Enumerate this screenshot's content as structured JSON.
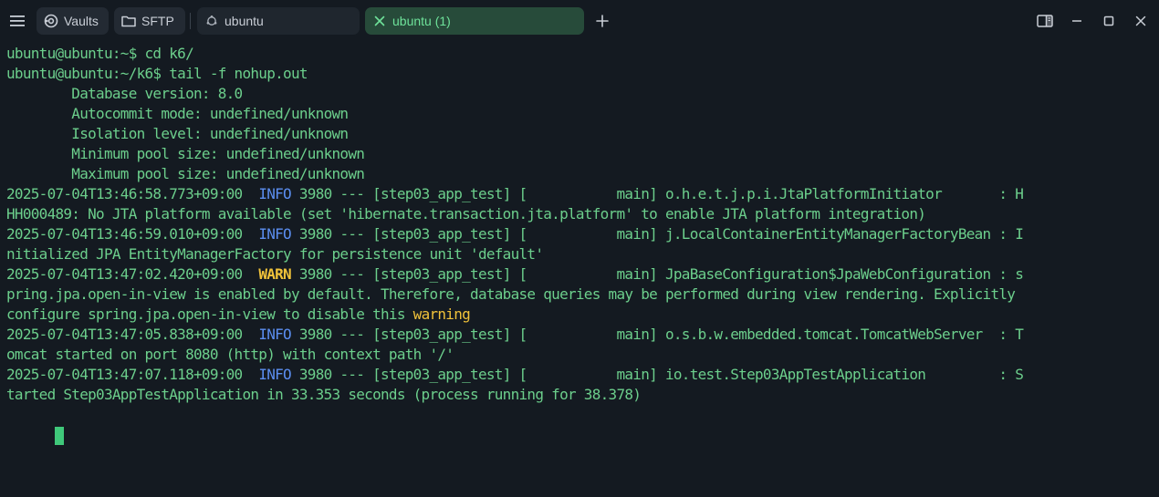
{
  "tabs": {
    "vaults": "Vaults",
    "sftp": "SFTP",
    "host": "ubuntu",
    "active": "ubuntu (1)"
  },
  "colors": {
    "background": "#141a21",
    "text": "#6ccf8c",
    "info": "#5b8ef0",
    "warn": "#f0c23a",
    "active_tab_bg": "#274b3a",
    "active_tab_text": "#6ee29a"
  },
  "icons": {
    "menu": "hamburger-icon",
    "vaults": "vault-icon",
    "sftp": "folder-icon",
    "host": "ubuntu-icon",
    "active": "close-icon",
    "new_tab": "plus-icon",
    "panel": "split-panel-icon",
    "minimize": "minimize-icon",
    "maximize": "maximize-icon",
    "close": "close-window-icon"
  },
  "terminal": {
    "lines": [
      {
        "segments": [
          {
            "text": "ubuntu@ubuntu:~$ cd k6/"
          }
        ]
      },
      {
        "segments": [
          {
            "text": "ubuntu@ubuntu:~/k6$ tail -f nohup.out"
          }
        ]
      },
      {
        "segments": [
          {
            "text": "        Database version: 8.0"
          }
        ]
      },
      {
        "segments": [
          {
            "text": "        Autocommit mode: undefined/unknown"
          }
        ]
      },
      {
        "segments": [
          {
            "text": "        Isolation level: undefined/unknown"
          }
        ]
      },
      {
        "segments": [
          {
            "text": "        Minimum pool size: undefined/unknown"
          }
        ]
      },
      {
        "segments": [
          {
            "text": "        Maximum pool size: undefined/unknown"
          }
        ]
      },
      {
        "segments": [
          {
            "text": "2025-07-04T13:46:58.773+09:00  "
          },
          {
            "text": "INFO",
            "cls": "lvl-info"
          },
          {
            "text": " 3980 --- [step03_app_test] [           main] o.h.e.t.j.p.i.JtaPlatformInitiator       : H"
          }
        ]
      },
      {
        "segments": [
          {
            "text": "HH000489: No JTA platform available (set 'hibernate.transaction.jta.platform' to enable JTA platform integration)"
          }
        ]
      },
      {
        "segments": [
          {
            "text": "2025-07-04T13:46:59.010+09:00  "
          },
          {
            "text": "INFO",
            "cls": "lvl-info"
          },
          {
            "text": " 3980 --- [step03_app_test] [           main] j.LocalContainerEntityManagerFactoryBean : I"
          }
        ]
      },
      {
        "segments": [
          {
            "text": "nitialized JPA EntityManagerFactory for persistence unit 'default'"
          }
        ]
      },
      {
        "segments": [
          {
            "text": "2025-07-04T13:47:02.420+09:00  "
          },
          {
            "text": "WARN",
            "cls": "lvl-warn"
          },
          {
            "text": " 3980 --- [step03_app_test] [           main] JpaBaseConfiguration$JpaWebConfiguration : s"
          }
        ]
      },
      {
        "segments": [
          {
            "text": "pring.jpa.open-in-view is enabled by default. Therefore, database queries may be performed during view rendering. Explicitly"
          }
        ]
      },
      {
        "segments": [
          {
            "text": "configure spring.jpa.open-in-view to disable this "
          },
          {
            "text": "warning",
            "cls": "hl-warn"
          }
        ]
      },
      {
        "segments": [
          {
            "text": "2025-07-04T13:47:05.838+09:00  "
          },
          {
            "text": "INFO",
            "cls": "lvl-info"
          },
          {
            "text": " 3980 --- [step03_app_test] [           main] o.s.b.w.embedded.tomcat.TomcatWebServer  : T"
          }
        ]
      },
      {
        "segments": [
          {
            "text": "omcat started on port 8080 (http) with context path '/'"
          }
        ]
      },
      {
        "segments": [
          {
            "text": "2025-07-04T13:47:07.118+09:00  "
          },
          {
            "text": "INFO",
            "cls": "lvl-info"
          },
          {
            "text": " 3980 --- [step03_app_test] [           main] io.test.Step03AppTestApplication         : S"
          }
        ]
      },
      {
        "segments": [
          {
            "text": "tarted Step03AppTestApplication in 33.353 seconds (process running for 38.378)"
          }
        ]
      }
    ]
  }
}
